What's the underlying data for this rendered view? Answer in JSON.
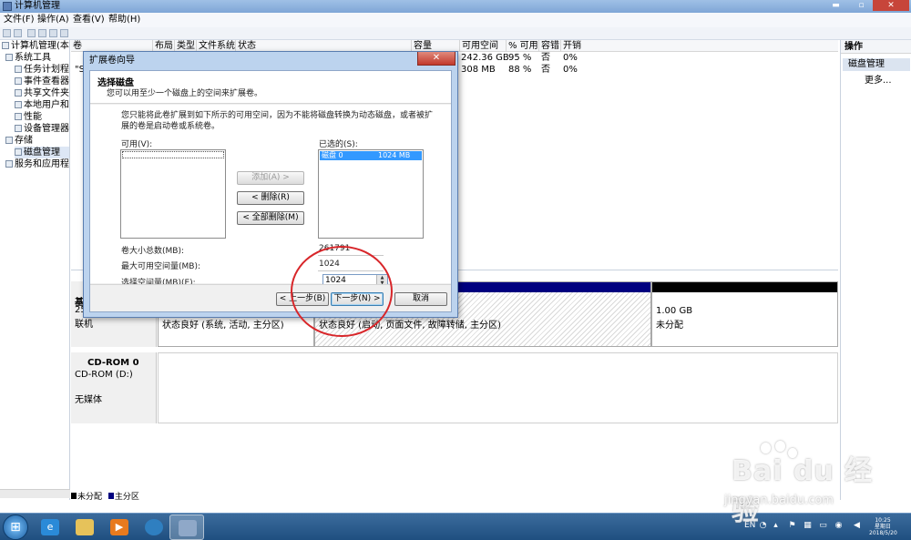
{
  "window": {
    "title": "计算机管理",
    "min_icon": "▬",
    "max_icon": "▫",
    "close_icon": "✕"
  },
  "menu": {
    "items": [
      "文件(F)",
      "操作(A)",
      "查看(V)",
      "帮助(H)"
    ]
  },
  "tree": {
    "items": [
      {
        "label": "计算机管理(本地",
        "indent": 0
      },
      {
        "label": "系统工具",
        "indent": 1
      },
      {
        "label": "任务计划程",
        "indent": 2
      },
      {
        "label": "事件查看器",
        "indent": 2
      },
      {
        "label": "共享文件夹",
        "indent": 2
      },
      {
        "label": "本地用户和",
        "indent": 2
      },
      {
        "label": "性能",
        "indent": 2
      },
      {
        "label": "设备管理器",
        "indent": 2
      },
      {
        "label": "存储",
        "indent": 1
      },
      {
        "label": "磁盘管理",
        "indent": 2
      },
      {
        "label": "服务和应用程",
        "indent": 1
      }
    ]
  },
  "volumes": {
    "columns": [
      "卷",
      "布局",
      "类型",
      "文件系统",
      "状态",
      "容量",
      "可用空间",
      "% 可用",
      "容错",
      "开销"
    ],
    "rows": [
      {
        "name": "",
        "capacity": "",
        "free": "242.36 GB",
        "pct": "95 %",
        "fault": "否",
        "overhead": "0%"
      },
      {
        "name": "\"S",
        "capacity": "",
        "free": "308 MB",
        "pct": "88 %",
        "fault": "否",
        "overhead": "0%"
      }
    ]
  },
  "actions": {
    "header": "操作",
    "section": "磁盘管理",
    "more": "更多..."
  },
  "disks": {
    "disk0_name": "基",
    "disk0_size": "25",
    "disk0_status": "联机",
    "seg1_status": "状态良好 (系统, 活动, 主分区)",
    "seg2_status": "状态良好 (启动, 页面文件, 故障转储, 主分区)",
    "seg3_size": "1.00 GB",
    "seg3_status": "未分配",
    "cdrom_name": "CD-ROM 0",
    "cdrom_drive": "CD-ROM (D:)",
    "cdrom_status": "无媒体"
  },
  "legend": {
    "unallocated": "未分配",
    "primary": "主分区"
  },
  "dialog": {
    "title": "扩展卷向导",
    "close_icon": "✕",
    "header_title": "选择磁盘",
    "header_subtitle": "您可以用至少一个磁盘上的空间来扩展卷。",
    "description": "您只能将此卷扩展到如下所示的可用空间，因为不能将磁盘转换为动态磁盘，或者被扩展的卷是启动卷或系统卷。",
    "available_label": "可用(V):",
    "selected_label": "已选的(S):",
    "selected_item_disk": "磁盘 0",
    "selected_item_size": "1024 MB",
    "add_button": "添加(A) >",
    "remove_button": "< 删除(R)",
    "remove_all_button": "< 全部删除(M)",
    "total_size_label": "卷大小总数(MB):",
    "total_size_value": "261791",
    "max_space_label": "最大可用空间量(MB):",
    "max_space_value": "1024",
    "select_space_label": "选择空间量(MB)(E):",
    "select_space_value": "1024",
    "back_button": "< 上一步(B)",
    "next_button": "下一步(N) >",
    "cancel_button": "取消"
  },
  "taskbar": {
    "start_icon": "⊞",
    "lang": "EN",
    "time": "10:25",
    "weekday": "星期日",
    "date": "2018/5/20"
  },
  "watermark": {
    "text": "Bai du 经验",
    "url": "jingyan.baidu.com"
  },
  "colors": {
    "primary_partition": "#00007f",
    "system_bar": "#000000",
    "unallocated": "#000000",
    "highlight": "#3399ff",
    "annotation": "#d8262a"
  }
}
